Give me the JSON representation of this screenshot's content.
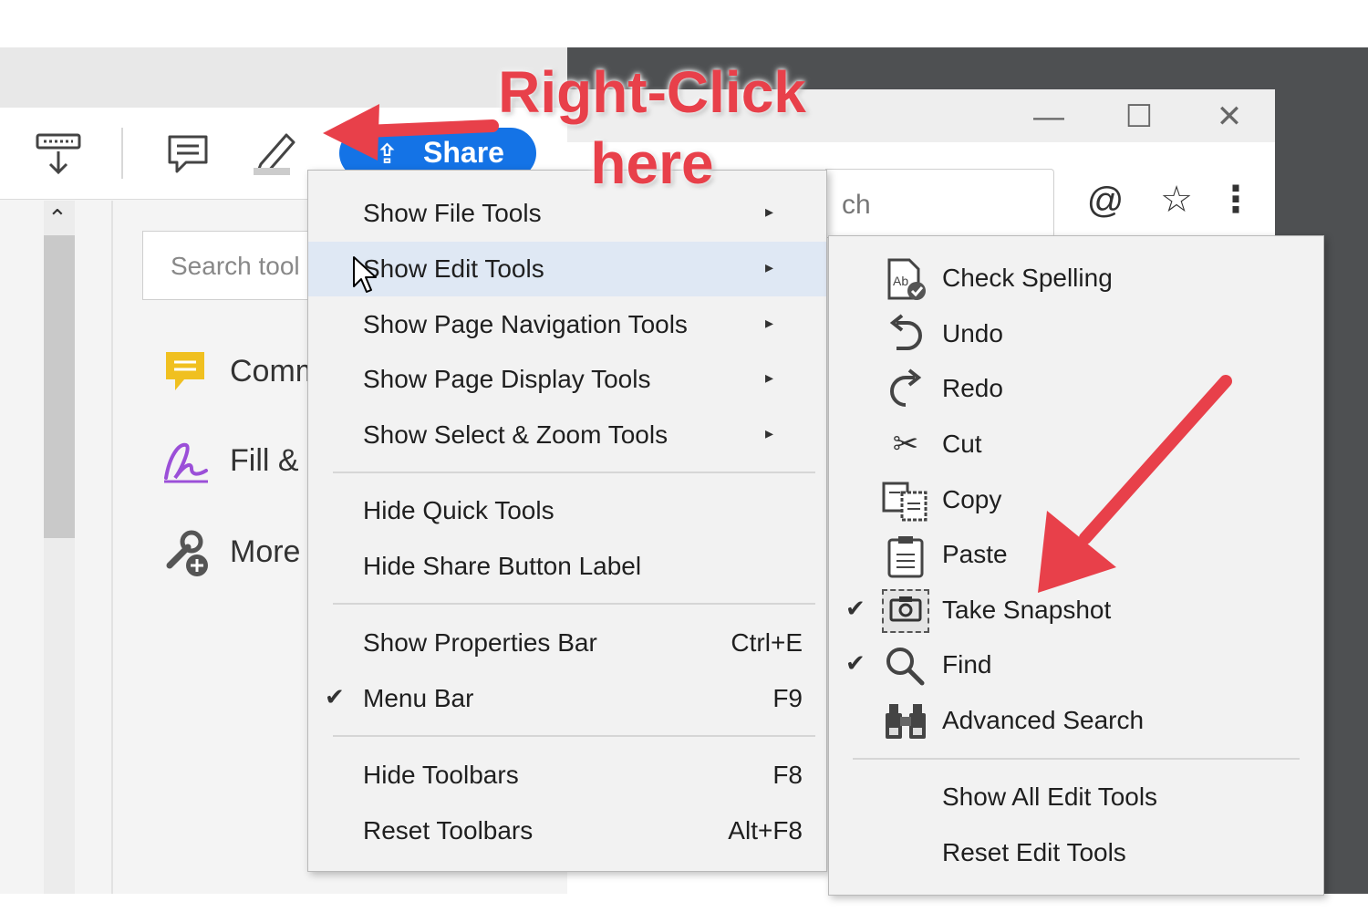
{
  "annotation": {
    "line1": "Right-Click",
    "line2": "here",
    "arrow_color": "#e8404a"
  },
  "acrobat": {
    "toolbar": {
      "share_label": "Share",
      "icons": [
        "save-to-device-icon",
        "comment-icon",
        "pen-icon",
        "share-icon"
      ]
    },
    "tools_search_placeholder": "Search tool",
    "tools": [
      {
        "label": "Comm",
        "icon": "comment-icon",
        "color": "#f0c020"
      },
      {
        "label": "Fill &",
        "icon": "fill-sign-icon",
        "color": "#9b4fd8"
      },
      {
        "label": "More",
        "icon": "more-tools-icon",
        "color": "#555555"
      }
    ]
  },
  "browser": {
    "search_text": "ch",
    "window_icons": [
      "minimize-icon",
      "maximize-icon",
      "close-icon"
    ],
    "toolbar_icons": [
      "at-icon",
      "star-icon",
      "more-icon"
    ]
  },
  "context_menu": {
    "items": [
      {
        "label": "Show File Tools",
        "arrow": true
      },
      {
        "label": "Show Edit Tools",
        "arrow": true,
        "highlighted": true
      },
      {
        "label": "Show Page Navigation Tools",
        "arrow": true
      },
      {
        "label": "Show Page Display Tools",
        "arrow": true
      },
      {
        "label": "Show Select & Zoom Tools",
        "arrow": true
      },
      {
        "label": "Hide Quick Tools"
      },
      {
        "label": "Hide Share Button Label"
      },
      {
        "label": "Show Properties Bar",
        "shortcut": "Ctrl+E"
      },
      {
        "label": "Menu Bar",
        "shortcut": "F9",
        "checked": true
      },
      {
        "label": "Hide Toolbars",
        "shortcut": "F8"
      },
      {
        "label": "Reset Toolbars",
        "shortcut": "Alt+F8"
      }
    ]
  },
  "submenu": {
    "items": [
      {
        "label": "Check Spelling",
        "icon": "spell-check-icon"
      },
      {
        "label": "Undo",
        "icon": "undo-icon"
      },
      {
        "label": "Redo",
        "icon": "redo-icon"
      },
      {
        "label": "Cut",
        "icon": "scissors-icon"
      },
      {
        "label": "Copy",
        "icon": "copy-icon"
      },
      {
        "label": "Paste",
        "icon": "clipboard-icon"
      },
      {
        "label": "Take Snapshot",
        "icon": "camera-icon",
        "checked": true
      },
      {
        "label": "Find",
        "icon": "magnifier-icon",
        "checked": true
      },
      {
        "label": "Advanced Search",
        "icon": "binoculars-icon"
      },
      {
        "label": "Show All Edit Tools"
      },
      {
        "label": "Reset Edit Tools"
      }
    ]
  },
  "glyphs": {
    "check": "✔",
    "arrow": "▸",
    "up": "⌃"
  }
}
